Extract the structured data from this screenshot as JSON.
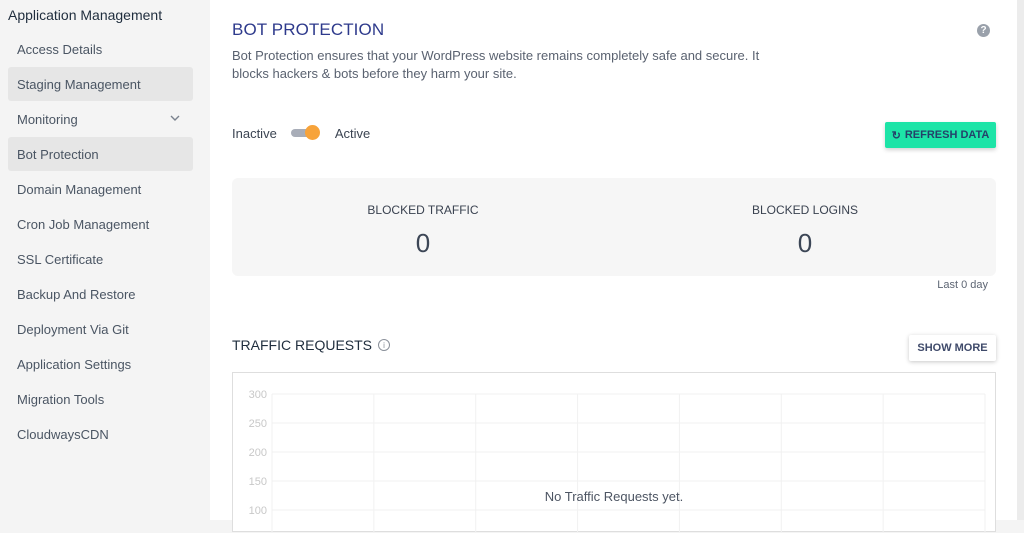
{
  "sidebar": {
    "heading": "Application Management",
    "items": [
      {
        "label": "Access Details",
        "active": false
      },
      {
        "label": "Staging Management",
        "active": true
      },
      {
        "label": "Monitoring",
        "active": false,
        "expandable": true
      },
      {
        "label": "Bot Protection",
        "active": true
      },
      {
        "label": "Domain Management",
        "active": false
      },
      {
        "label": "Cron Job Management",
        "active": false
      },
      {
        "label": "SSL Certificate",
        "active": false
      },
      {
        "label": "Backup And Restore",
        "active": false
      },
      {
        "label": "Deployment Via Git",
        "active": false
      },
      {
        "label": "Application Settings",
        "active": false
      },
      {
        "label": "Migration Tools",
        "active": false
      },
      {
        "label": "CloudwaysCDN",
        "active": false
      }
    ]
  },
  "header": {
    "title": "BOT PROTECTION",
    "help_icon": "question-circle-icon",
    "description": "Bot Protection ensures that your WordPress website remains completely safe and secure. It blocks hackers & bots before they harm your site."
  },
  "toggle": {
    "off_label": "Inactive",
    "on_label": "Active",
    "state": "active"
  },
  "refresh_button": {
    "icon": "refresh-icon",
    "label": "REFRESH DATA",
    "color": "#1de4a7"
  },
  "stats": [
    {
      "label": "BLOCKED TRAFFIC",
      "value": "0"
    },
    {
      "label": "BLOCKED LOGINS",
      "value": "0"
    }
  ],
  "stats_period": "Last 0 day",
  "traffic": {
    "title": "TRAFFIC REQUESTS",
    "show_more_label": "SHOW MORE",
    "empty_message": "No Traffic Requests yet."
  },
  "chart_data": {
    "type": "line",
    "title": "TRAFFIC REQUESTS",
    "xlabel": "",
    "ylabel": "",
    "series": [],
    "y_ticks": [
      300,
      250,
      200,
      150,
      100
    ],
    "ylim_visible": [
      100,
      300
    ],
    "x_columns": 7,
    "grid": true,
    "empty_message": "No Traffic Requests yet."
  },
  "colors": {
    "title": "#2e3a8c",
    "toggle_knob": "#f7a33a",
    "accent": "#1de4a7"
  }
}
